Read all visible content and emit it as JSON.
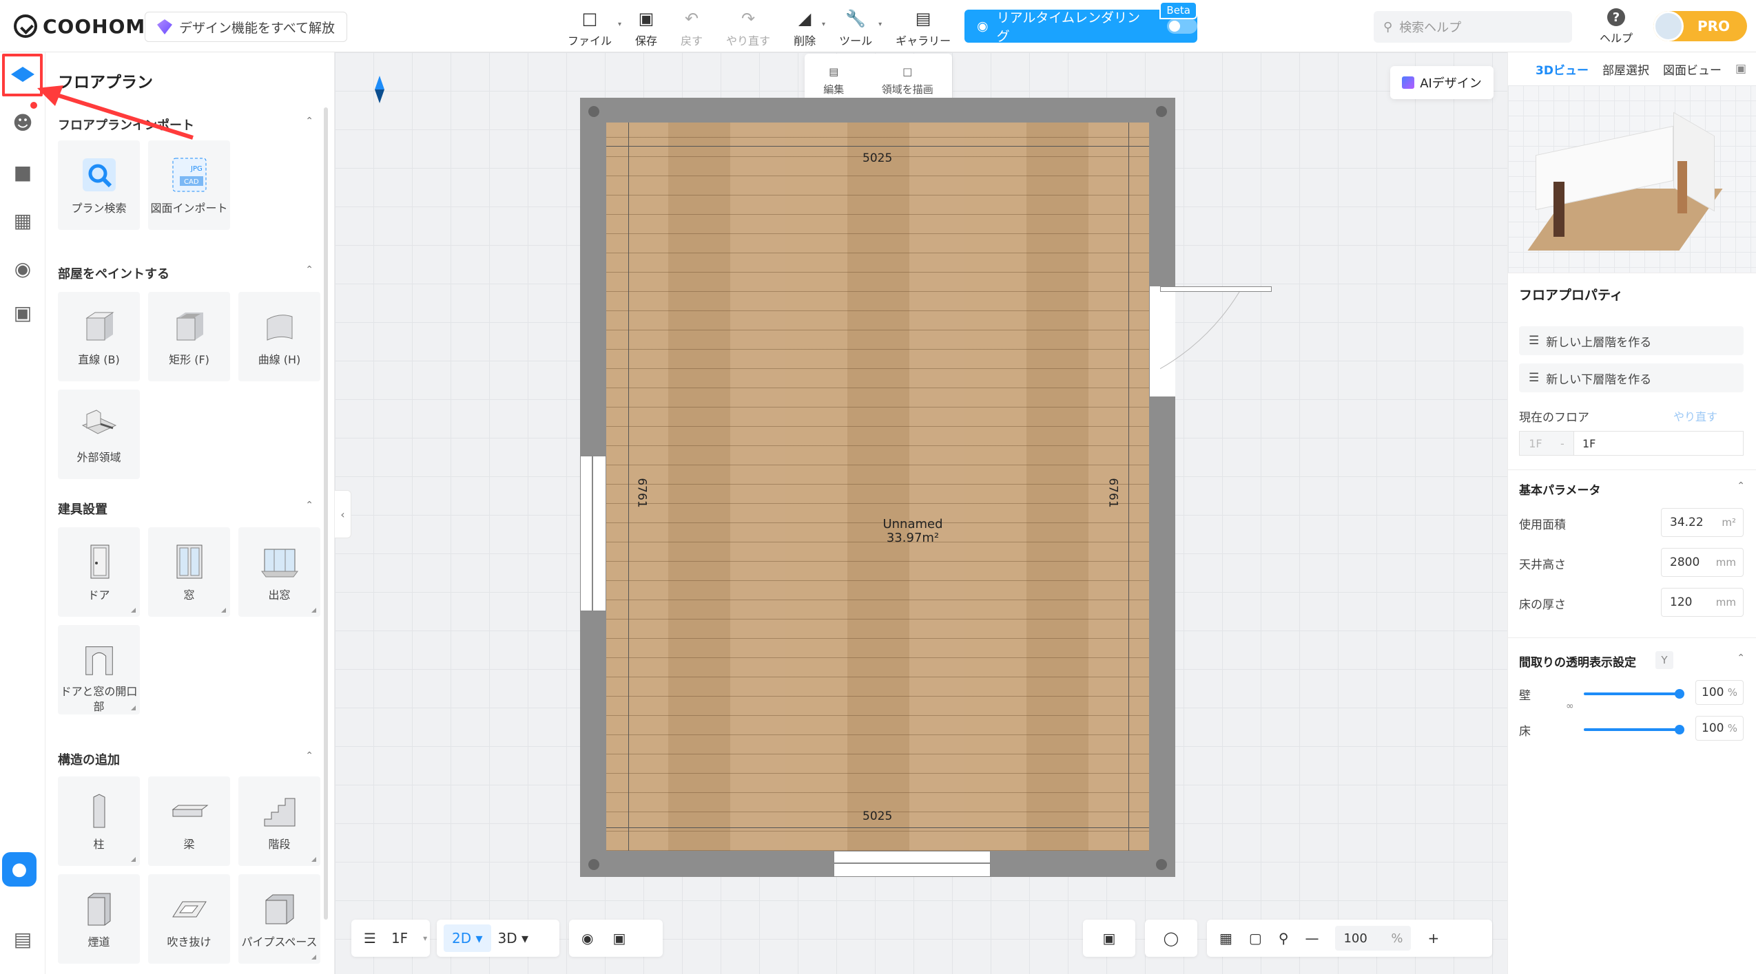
{
  "header": {
    "logo": "COOHOM",
    "unlock_label": "デザイン機能をすべて解放",
    "tools": [
      {
        "label": "ファイル",
        "icon": "file-icon"
      },
      {
        "label": "保存",
        "icon": "save-icon"
      },
      {
        "label": "戻す",
        "icon": "undo-icon"
      },
      {
        "label": "やり直す",
        "icon": "redo-icon"
      },
      {
        "label": "削除",
        "icon": "eraser-icon"
      },
      {
        "label": "ツール",
        "icon": "wrench-icon"
      },
      {
        "label": "ギャラリー",
        "icon": "gallery-icon"
      }
    ],
    "render_label": "リアルタイムレンダリング",
    "beta": "Beta",
    "search_placeholder": "検索ヘルプ",
    "help_label": "ヘルプ",
    "pro_label": "PRO"
  },
  "panel": {
    "title": "フロアプラン",
    "sections": [
      {
        "title": "フロアプランインポート",
        "items": [
          "プラン検索",
          "図面インポート"
        ]
      },
      {
        "title": "部屋をペイントする",
        "items": [
          "直線 (B)",
          "矩形 (F)",
          "曲線 (H)",
          "外部領域"
        ]
      },
      {
        "title": "建具設置",
        "items": [
          "ドア",
          "窓",
          "出窓",
          "ドアと窓の開口部"
        ]
      },
      {
        "title": "構造の追加",
        "items": [
          "柱",
          "梁",
          "階段",
          "煙道",
          "吹き抜け",
          "パイプスペース"
        ]
      }
    ]
  },
  "canvas": {
    "edit_label": "編集",
    "draw_label": "領域を描画",
    "ai_label": "AIデザイン",
    "dim_top": "5025",
    "dim_bottom": "5025",
    "dim_left": "6761",
    "dim_right": "6761",
    "room_name": "Unnamed",
    "room_area": "33.97m²"
  },
  "bottom": {
    "floor": "1F",
    "mode_2d": "2D",
    "mode_3d": "3D",
    "zoom": "100",
    "zoom_unit": "%"
  },
  "right_panel": {
    "tabs": [
      "3Dビュー",
      "部屋選択",
      "図面ビュー"
    ],
    "title": "フロアプロパティ",
    "new_upper": "新しい上層階を作る",
    "new_lower": "新しい下層階を作る",
    "current_floor_label": "現在のフロア",
    "redo_label": "やり直す",
    "floor_prefix": "1F",
    "floor_name": "1F",
    "basic_params": "基本パラメータ",
    "area_label": "使用面積",
    "area_value": "34.22",
    "area_unit": "m²",
    "ceiling_label": "天井高さ",
    "ceiling_value": "2800",
    "ceiling_unit": "mm",
    "thickness_label": "床の厚さ",
    "thickness_value": "120",
    "thickness_unit": "mm",
    "transparency_title": "間取りの透明表示設定",
    "transparency_key": "Y",
    "wall_label": "壁",
    "wall_value": "100",
    "floor_label": "床",
    "floor_value": "100",
    "pct": "%"
  }
}
